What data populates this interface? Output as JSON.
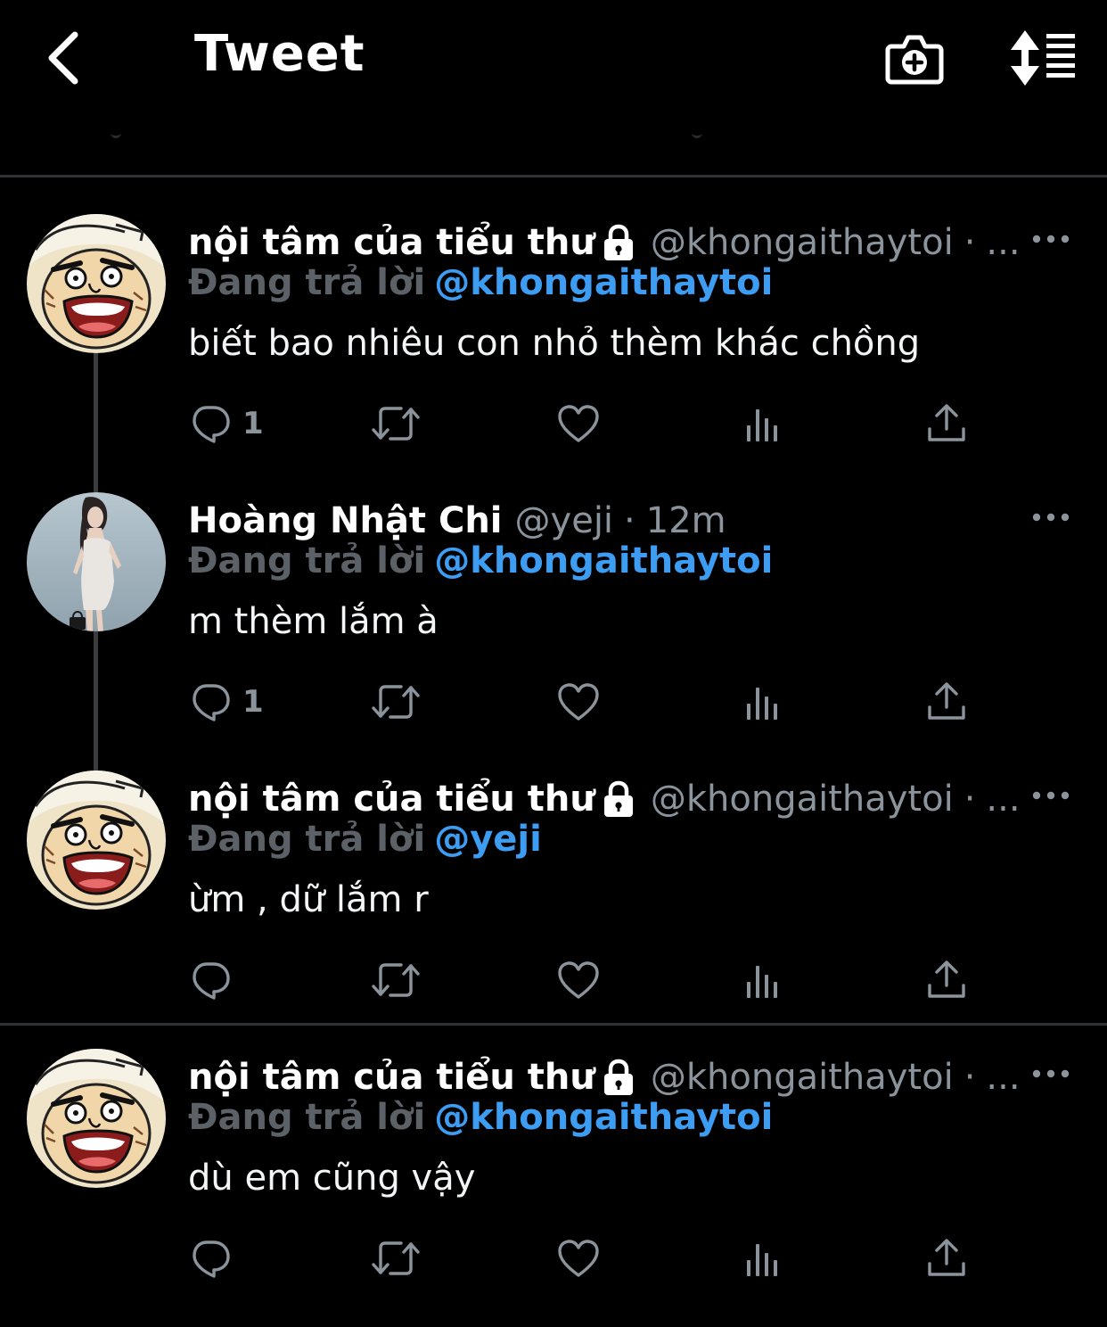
{
  "header": {
    "title": "Tweet",
    "back_icon": "chevron-left-icon",
    "camera_icon": "camera-add-icon",
    "sort_icon": "sort-list-icon"
  },
  "colors": {
    "background": "#000000",
    "accent_blue": "#3d9df2",
    "muted_gray": "#8b949c",
    "divider": "#2f3336"
  },
  "tweets": [
    {
      "display_name": "nội tâm của tiểu thư",
      "locked": true,
      "handle": "@khongaithaytoi",
      "separator": "·",
      "time": "...",
      "reply_label": "Đang trả lời",
      "reply_to": "@khongaithaytoi",
      "text": "biết bao nhiêu con nhỏ thèm khác chồng",
      "reply_count": "1",
      "avatar": "cartoon-face"
    },
    {
      "display_name": "Hoàng Nhật Chi",
      "locked": false,
      "handle": "@yeji",
      "separator": "·",
      "time": "12m",
      "reply_label": "Đang trả lời",
      "reply_to": "@khongaithaytoi",
      "text": "m thèm lắm à",
      "reply_count": "1",
      "avatar": "photo-woman"
    },
    {
      "display_name": "nội tâm của tiểu thư",
      "locked": true,
      "handle": "@khongaithaytoi",
      "separator": "·",
      "time": "...",
      "reply_label": "Đang trả lời",
      "reply_to": "@yeji",
      "text": "ừm , dữ lắm r",
      "reply_count": "",
      "avatar": "cartoon-face"
    },
    {
      "display_name": "nội tâm của tiểu thư",
      "locked": true,
      "handle": "@khongaithaytoi",
      "separator": "·",
      "time": "...",
      "reply_label": "Đang trả lời",
      "reply_to": "@khongaithaytoi",
      "text": "dù em cũng vậy",
      "reply_count": "",
      "avatar": "cartoon-face"
    }
  ]
}
